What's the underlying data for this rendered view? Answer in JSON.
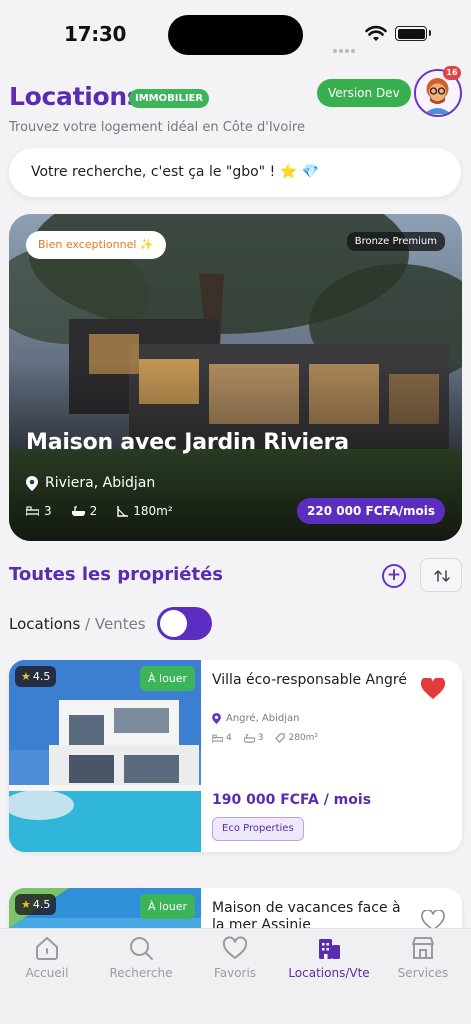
{
  "status_bar": {
    "time": "17:30"
  },
  "header": {
    "title": "Locations",
    "badge": "IMMOBILIER",
    "dev_button": "Version Dev",
    "notification_count": "16",
    "subtitle": "Trouvez votre logement idéal en Côte d'Ivoire"
  },
  "search": {
    "text": "Votre recherche, c'est ça le \"gbo\" ! ⭐ 💎"
  },
  "featured": {
    "badge_left": "Bien exceptionnel ✨",
    "badge_right": "Bronze Premium",
    "title": "Maison avec Jardin Riviera",
    "location": "Riviera, Abidjan",
    "bedrooms": "3",
    "bathrooms": "2",
    "area": "180m²",
    "price": "220 000 FCFA/mois"
  },
  "section": {
    "title": "Toutes les propriétés",
    "toggle_left": "Locations",
    "toggle_sep": " / ",
    "toggle_right": "Ventes"
  },
  "listings": [
    {
      "rating": "4.5",
      "status": "À louer",
      "title": "Villa éco-responsable Angré",
      "location": "Angré, Abidjan",
      "bedrooms": "4",
      "bathrooms": "3",
      "area": "280m²",
      "price": "190 000 FCFA / mois",
      "agency": "Eco Properties",
      "favorite": true
    },
    {
      "rating": "4.5",
      "status": "À louer",
      "title": "Maison de vacances face à la mer Assinie",
      "favorite": false
    }
  ],
  "nav": [
    {
      "label": "Accueil",
      "icon": "home-icon"
    },
    {
      "label": "Recherche",
      "icon": "search-icon"
    },
    {
      "label": "Favoris",
      "icon": "heart-icon"
    },
    {
      "label": "Locations/Vte",
      "icon": "building-icon",
      "active": true
    },
    {
      "label": "Services",
      "icon": "store-icon"
    }
  ],
  "colors": {
    "primary": "#5b2bb0",
    "accent_green": "#3cb45a",
    "favorite_red": "#e23b3b"
  }
}
